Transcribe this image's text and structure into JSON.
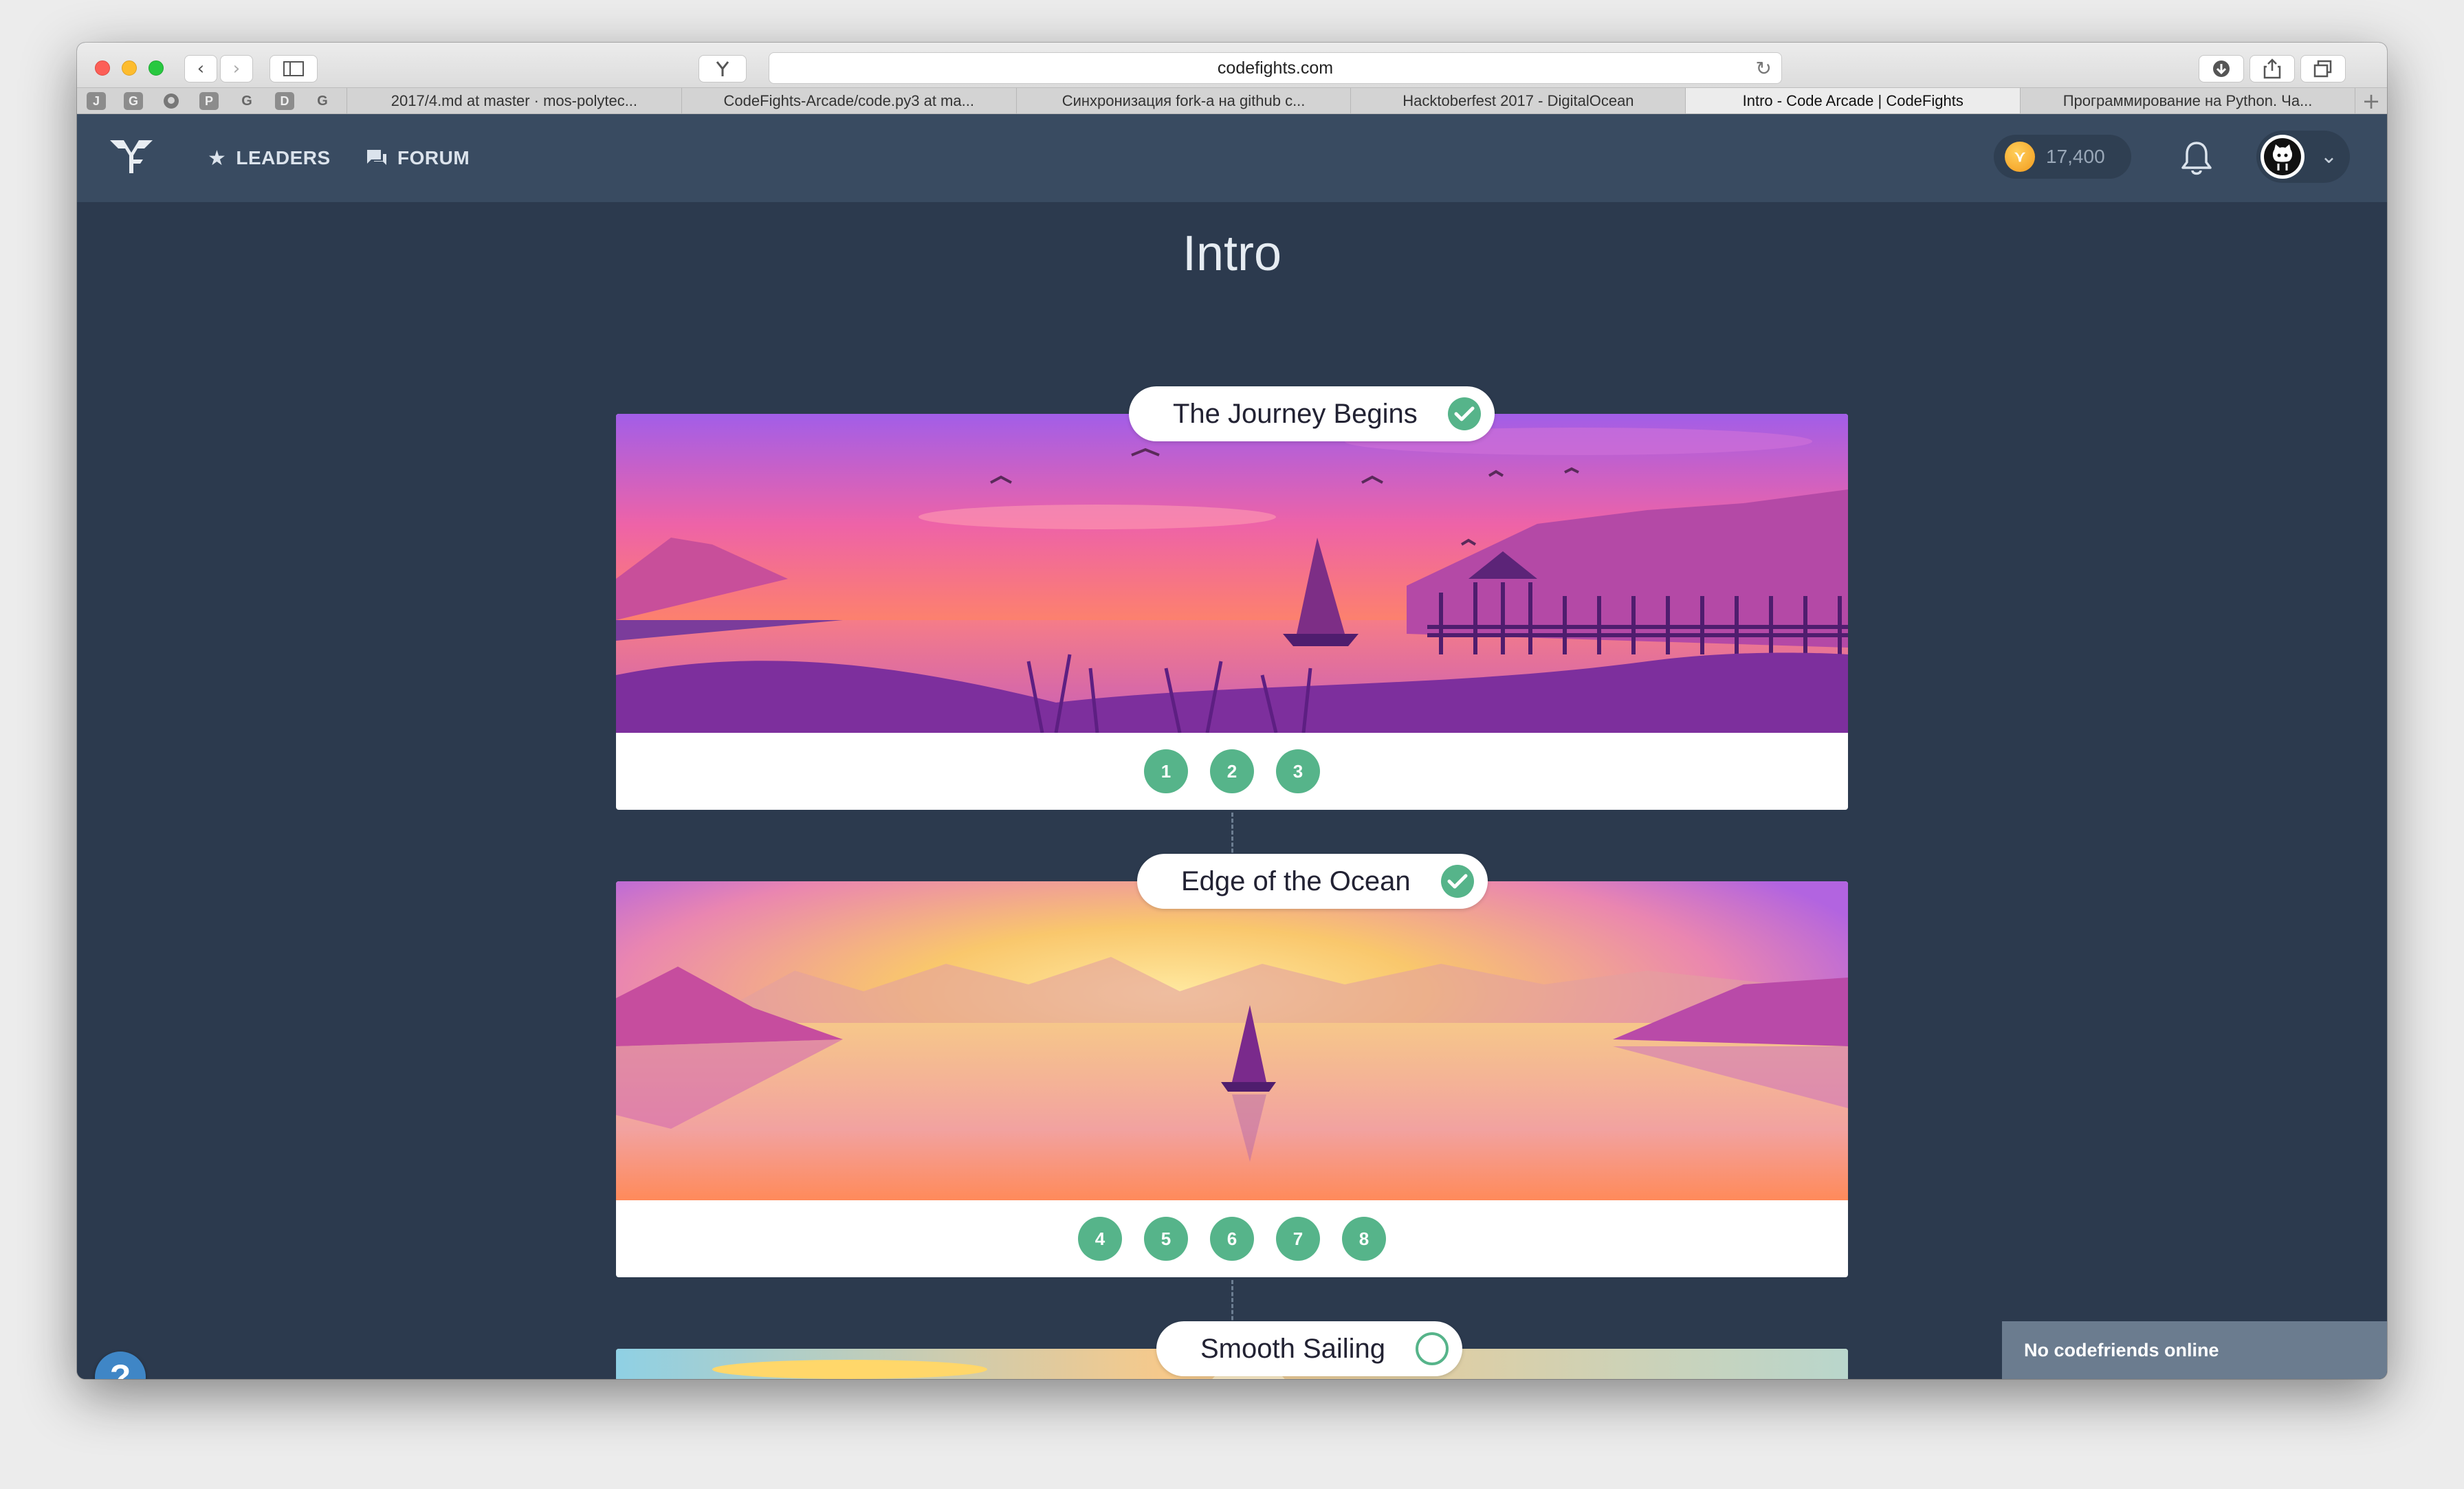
{
  "browser": {
    "url": "codefights.com",
    "pinned_tabs": [
      "J",
      "G",
      "github",
      "P",
      "G",
      "D",
      "G"
    ],
    "tabs": [
      {
        "label": "2017/4.md at master · mos-polytec...",
        "active": false
      },
      {
        "label": "CodeFights-Arcade/code.py3 at ma...",
        "active": false
      },
      {
        "label": "Синхронизация fork-а на github с...",
        "active": false
      },
      {
        "label": "Hacktoberfest 2017 - DigitalOcean",
        "active": false
      },
      {
        "label": "Intro - Code Arcade | CodeFights",
        "active": true
      },
      {
        "label": "Программирование на Python. Ча...",
        "active": false
      }
    ],
    "new_tab_label": "+"
  },
  "header": {
    "nav": [
      {
        "label": "LEADERS",
        "icon": "star-icon"
      },
      {
        "label": "FORUM",
        "icon": "forum-icon"
      }
    ],
    "coins": "17,400"
  },
  "page": {
    "title": "Intro",
    "sections": [
      {
        "title": "The Journey Begins",
        "completed": true,
        "levels": [
          "1",
          "2",
          "3"
        ]
      },
      {
        "title": "Edge of the Ocean",
        "completed": true,
        "levels": [
          "4",
          "5",
          "6",
          "7",
          "8"
        ]
      },
      {
        "title": "Smooth Sailing",
        "completed": false,
        "levels": []
      }
    ]
  },
  "help_label": "?",
  "friends_status": "No codefriends online",
  "colors": {
    "accent_green": "#56b48a",
    "header_bg": "#394b61",
    "page_bg": "#2c3a4e"
  }
}
